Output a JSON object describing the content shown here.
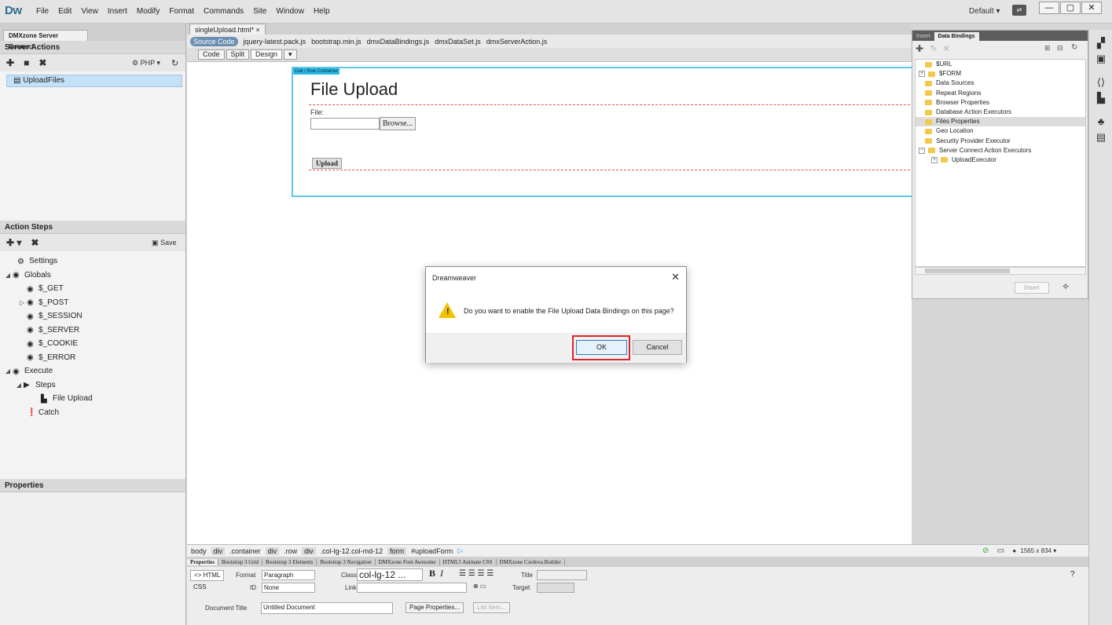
{
  "app": {
    "logo": "Dw",
    "menus": [
      "File",
      "Edit",
      "View",
      "Insert",
      "Modify",
      "Format",
      "Commands",
      "Site",
      "Window",
      "Help"
    ],
    "layout": "Default ▾",
    "window_buttons": [
      "—",
      "▢",
      "✕"
    ]
  },
  "left_panel": {
    "tab": "DMXzone Server Connect",
    "server_actions_header": "Server Actions",
    "server_actions_toolbar": {
      "add": "✚",
      "folder": "■",
      "delete": "✖",
      "lang": "⚙ PHP ▾",
      "refresh": "↻"
    },
    "server_actions": [
      "UploadFiles"
    ],
    "action_steps_header": "Action Steps",
    "action_steps_toolbar": {
      "add": "✚ ▾",
      "delete": "✖",
      "save": "Save"
    },
    "tree": [
      {
        "label": "Settings",
        "level": 1,
        "icon": "gear-icon"
      },
      {
        "label": "Globals",
        "level": 0,
        "icon": "cube-icon",
        "expanded": true
      },
      {
        "label": "$_GET",
        "level": 2,
        "icon": "cube-icon"
      },
      {
        "label": "$_POST",
        "level": 1,
        "icon": "cube-icon",
        "collapsed": true
      },
      {
        "label": "$_SESSION",
        "level": 2,
        "icon": "cube-icon"
      },
      {
        "label": "$_SERVER",
        "level": 2,
        "icon": "cube-icon"
      },
      {
        "label": "$_COOKIE",
        "level": 2,
        "icon": "cube-icon"
      },
      {
        "label": "$_ERROR",
        "level": 2,
        "icon": "cube-icon"
      },
      {
        "label": "Execute",
        "level": 0,
        "icon": "cube-icon",
        "expanded": true
      },
      {
        "label": "Steps",
        "level": 1,
        "icon": "play-icon",
        "expanded": true
      },
      {
        "label": "File Upload",
        "level": 3,
        "icon": "file-upload-icon"
      },
      {
        "label": "Catch",
        "level": 2,
        "icon": "alert-icon"
      }
    ],
    "properties_header": "Properties"
  },
  "document": {
    "tab": "singleUpload.html* ×",
    "related_files": [
      "Source Code",
      "jquery-latest.pack.js",
      "bootstrap.min.js",
      "dmxDataBindings.js",
      "dmxDataSet.js",
      "dmxServerAction.js"
    ],
    "view_buttons": [
      "Code",
      "Split",
      "Design",
      "▾"
    ],
    "cell_label": "Cell / Row Container",
    "heading": "File Upload",
    "file_label": "File:",
    "browse": "Browse...",
    "upload": "Upload"
  },
  "tag_selector": {
    "tags": [
      "body",
      "div",
      ".container",
      "div",
      ".row",
      "div",
      ".col-lg-12.col-md-12",
      "form",
      "#uploadForm"
    ],
    "size": "1565 x 834 ▾"
  },
  "inspector": {
    "tabs": [
      "Properties",
      "Bootstrap 3 Grid",
      "Bootstrap 3 Elements",
      "Bootstrap 3 Navigation",
      "DMXzone Font Awesome",
      "HTML5 Animate CSS",
      "DMXzone Cordova Builder"
    ],
    "html_btn": "<> HTML",
    "css_btn": "CSS",
    "format_label": "Format",
    "format_value": "Paragraph",
    "id_label": "ID",
    "id_value": "None",
    "class_label": "Class",
    "class_value": "col-lg-12 ...",
    "link_label": "Link",
    "title_label": "Title",
    "target_label": "Target",
    "doc_title_label": "Document Title",
    "doc_title_value": "Untitled Document",
    "page_props": "Page Properties...",
    "list_item": "List Item..."
  },
  "bindings": {
    "tabs": [
      "Insert",
      "Data Bindings"
    ],
    "items": [
      {
        "label": "$URL",
        "fold": ""
      },
      {
        "label": "$FORM",
        "fold": "+"
      },
      {
        "label": "Data Sources",
        "fold": ""
      },
      {
        "label": "Repeat Regions",
        "fold": ""
      },
      {
        "label": "Browser Properties",
        "fold": ""
      },
      {
        "label": "Database Action Executors",
        "fold": ""
      },
      {
        "label": "Files Properties",
        "fold": "",
        "selected": true
      },
      {
        "label": "Geo Location",
        "fold": ""
      },
      {
        "label": "Security Provider Executor",
        "fold": ""
      },
      {
        "label": "Server Connect Action Executors",
        "fold": "−"
      },
      {
        "label": "UploadExecutor",
        "fold": "+",
        "indent": true
      }
    ],
    "insert": "Insert"
  },
  "dialog": {
    "title": "Dreamweaver",
    "message": "Do you want to enable the File Upload Data Bindings on this page?",
    "ok": "OK",
    "cancel": "Cancel"
  }
}
